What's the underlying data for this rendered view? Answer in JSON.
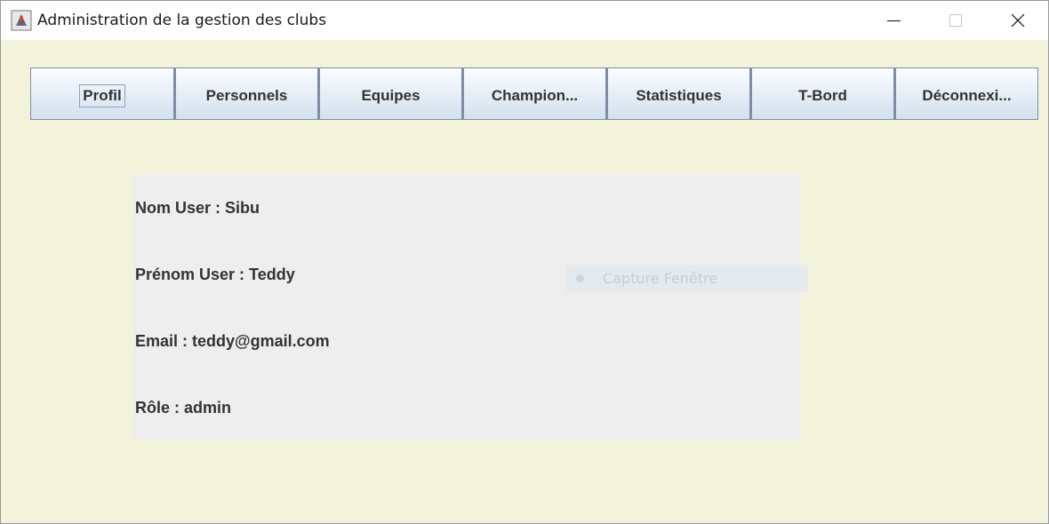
{
  "window": {
    "title": "Administration de la gestion des clubs",
    "icon": "java-app-icon",
    "controls": {
      "minimize_icon": "minimize-icon",
      "maximize_icon": "maximize-icon",
      "close_icon": "close-icon"
    }
  },
  "tabs": [
    {
      "label": "Profil",
      "focused": true
    },
    {
      "label": "Personnels"
    },
    {
      "label": "Equipes"
    },
    {
      "label": "Champion..."
    },
    {
      "label": "Statistiques"
    },
    {
      "label": "T-Bord"
    },
    {
      "label": "Déconnexi..."
    }
  ],
  "profile": {
    "nom": "Nom User : Sibu",
    "prenom": "Prénom User : Teddy",
    "email": "Email : teddy@gmail.com",
    "role": "Rôle : admin"
  },
  "overlay": {
    "label": "Capture Fenêtre"
  },
  "colors": {
    "background": "#f3f3dc",
    "panel": "#eeeeee",
    "text": "#333333",
    "button_border": "#7e8fa3"
  }
}
